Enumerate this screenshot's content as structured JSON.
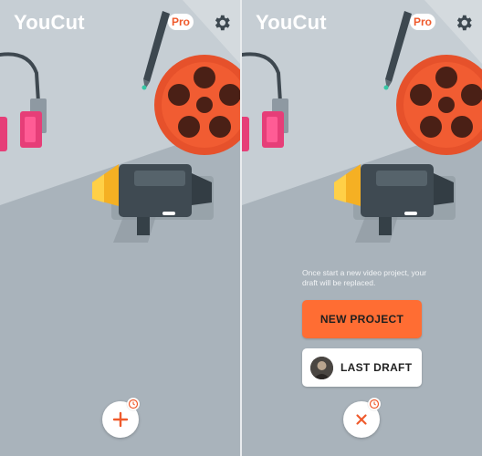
{
  "app": {
    "name": "YouCut",
    "pro_badge": "Pro"
  },
  "icons": {
    "settings": "gear-icon",
    "add": "plus-icon",
    "close": "close-icon",
    "history": "clock-icon"
  },
  "colors": {
    "background": "#a9b3bb",
    "accent": "#ff6d33",
    "fab_icon": "#ef5a2c"
  },
  "left_screen": {
    "fab_icon": "plus"
  },
  "right_screen": {
    "hint": "Once start a new video project, your draft will be replaced.",
    "new_project_label": "NEW PROJECT",
    "last_draft_label": "LAST DRAFT",
    "fab_icon": "close"
  }
}
